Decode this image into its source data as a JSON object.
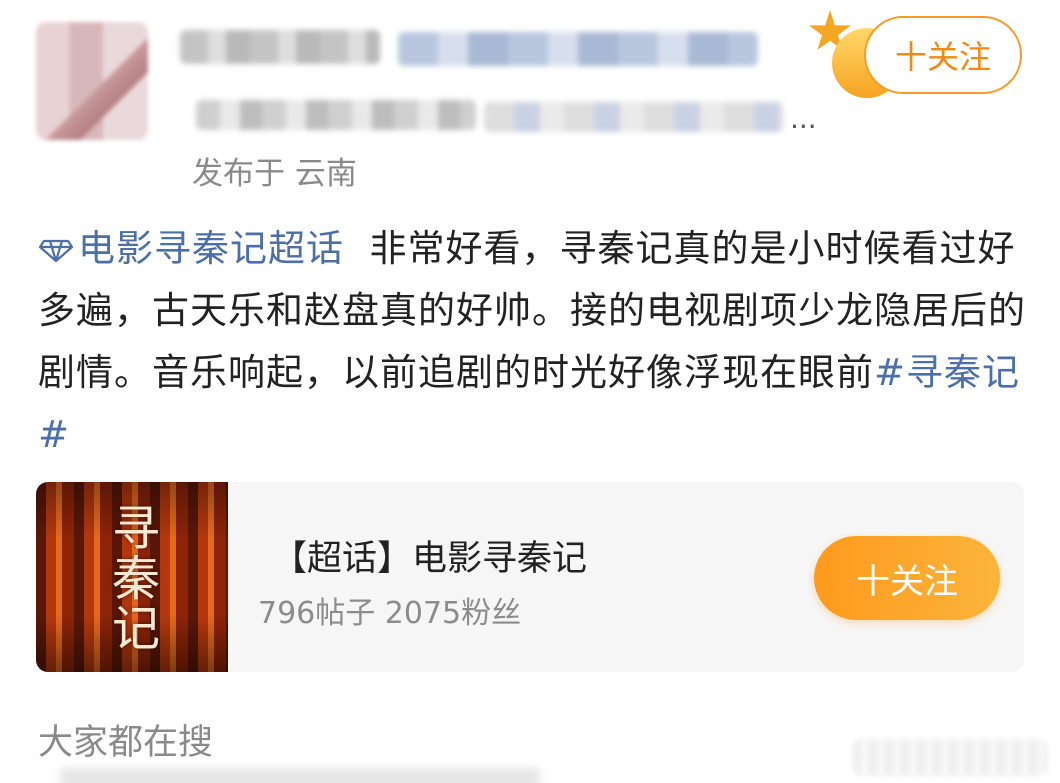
{
  "header": {
    "truncated_suffix": "...",
    "location_label": "发布于 云南",
    "follow_label": "十关注"
  },
  "post": {
    "topic_link": "电影寻秦记超话",
    "body_text": "非常好看，寻秦记真的是小时候看过好多遍，古天乐和赵盘真的好帅。接的电视剧项少龙隐居后的剧情。音乐响起，以前追剧的时光好像浮现在眼前",
    "hashtag": "#寻秦记#"
  },
  "topic_card": {
    "poster_title": "寻秦记",
    "title": "【超话】电影寻秦记",
    "stats": "796帖子 2075粉丝",
    "follow_label": "十关注"
  },
  "search_section": {
    "heading": "大家都在搜"
  },
  "colors": {
    "link": "#4c6fa8",
    "follow_orange": "#f28a12",
    "secondary_text": "#8a8a8a"
  }
}
